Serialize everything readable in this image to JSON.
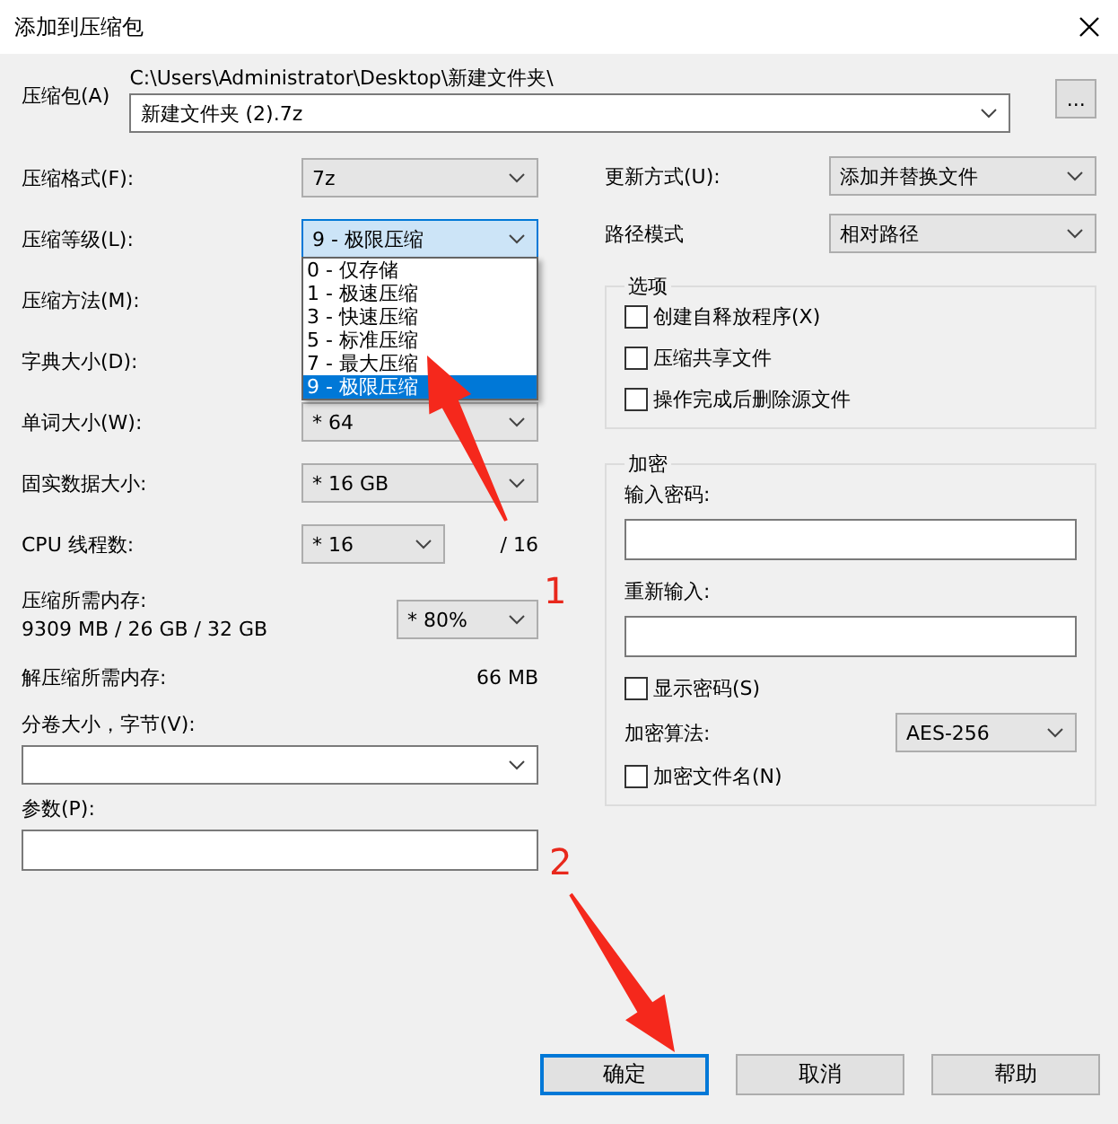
{
  "window": {
    "title": "添加到压缩包"
  },
  "archive": {
    "label": "压缩包(A)",
    "path": "C:\\Users\\Administrator\\Desktop\\新建文件夹\\",
    "value": "新建文件夹 (2).7z",
    "browse": "..."
  },
  "left_rows": [
    {
      "kind": "combo",
      "label": "压缩格式(F):",
      "value": "7z",
      "focused": false
    },
    {
      "kind": "combo",
      "label": "压缩等级(L):",
      "value": "9 - 极限压缩",
      "focused": true
    },
    {
      "kind": "covered",
      "label": "压缩方法(M):"
    },
    {
      "kind": "covered",
      "label": "字典大小(D):"
    },
    {
      "kind": "combo",
      "label": "单词大小(W):",
      "value": "* 64",
      "focused": false
    },
    {
      "kind": "combo",
      "label": "固实数据大小:",
      "value": "* 16 GB",
      "focused": false
    },
    {
      "kind": "cpu",
      "label": "CPU 线程数:",
      "value": "* 16",
      "suffix": "/ 16"
    },
    {
      "kind": "memory",
      "label": "压缩所需内存:",
      "detail": "9309 MB / 26 GB / 32 GB",
      "value": "* 80%"
    },
    {
      "kind": "info",
      "label": "解压缩所需内存:",
      "value": "66 MB"
    }
  ],
  "level_list": [
    {
      "label": "0 - 仅存储",
      "selected": false
    },
    {
      "label": "1 - 极速压缩",
      "selected": false
    },
    {
      "label": "3 - 快速压缩",
      "selected": false
    },
    {
      "label": "5 - 标准压缩",
      "selected": false
    },
    {
      "label": "7 - 最大压缩",
      "selected": false
    },
    {
      "label": "9 - 极限压缩",
      "selected": true
    }
  ],
  "volume": {
    "label": "分卷大小，字节(V):"
  },
  "parameters": {
    "label": "参数(P):"
  },
  "update_mode": {
    "label": "更新方式(U):",
    "value": "添加并替换文件"
  },
  "path_mode": {
    "label": "路径模式",
    "value": "相对路径"
  },
  "options": {
    "title": "选项",
    "items": [
      {
        "label": "创建自释放程序(X)",
        "checked": false
      },
      {
        "label": "压缩共享文件",
        "checked": false
      },
      {
        "label": "操作完成后删除源文件",
        "checked": false
      }
    ]
  },
  "encryption": {
    "title": "加密",
    "password_label": "输入密码:",
    "reenter_label": "重新输入:",
    "show_password": {
      "label": "显示密码(S)",
      "checked": false
    },
    "method": {
      "label": "加密算法:",
      "value": "AES-256"
    },
    "encrypt_names": {
      "label": "加密文件名(N)",
      "checked": false
    }
  },
  "buttons": [
    {
      "label": "确定",
      "default": true
    },
    {
      "label": "取消",
      "default": false
    },
    {
      "label": "帮助",
      "default": false
    }
  ],
  "annotations": [
    {
      "label": "1"
    },
    {
      "label": "2"
    }
  ]
}
